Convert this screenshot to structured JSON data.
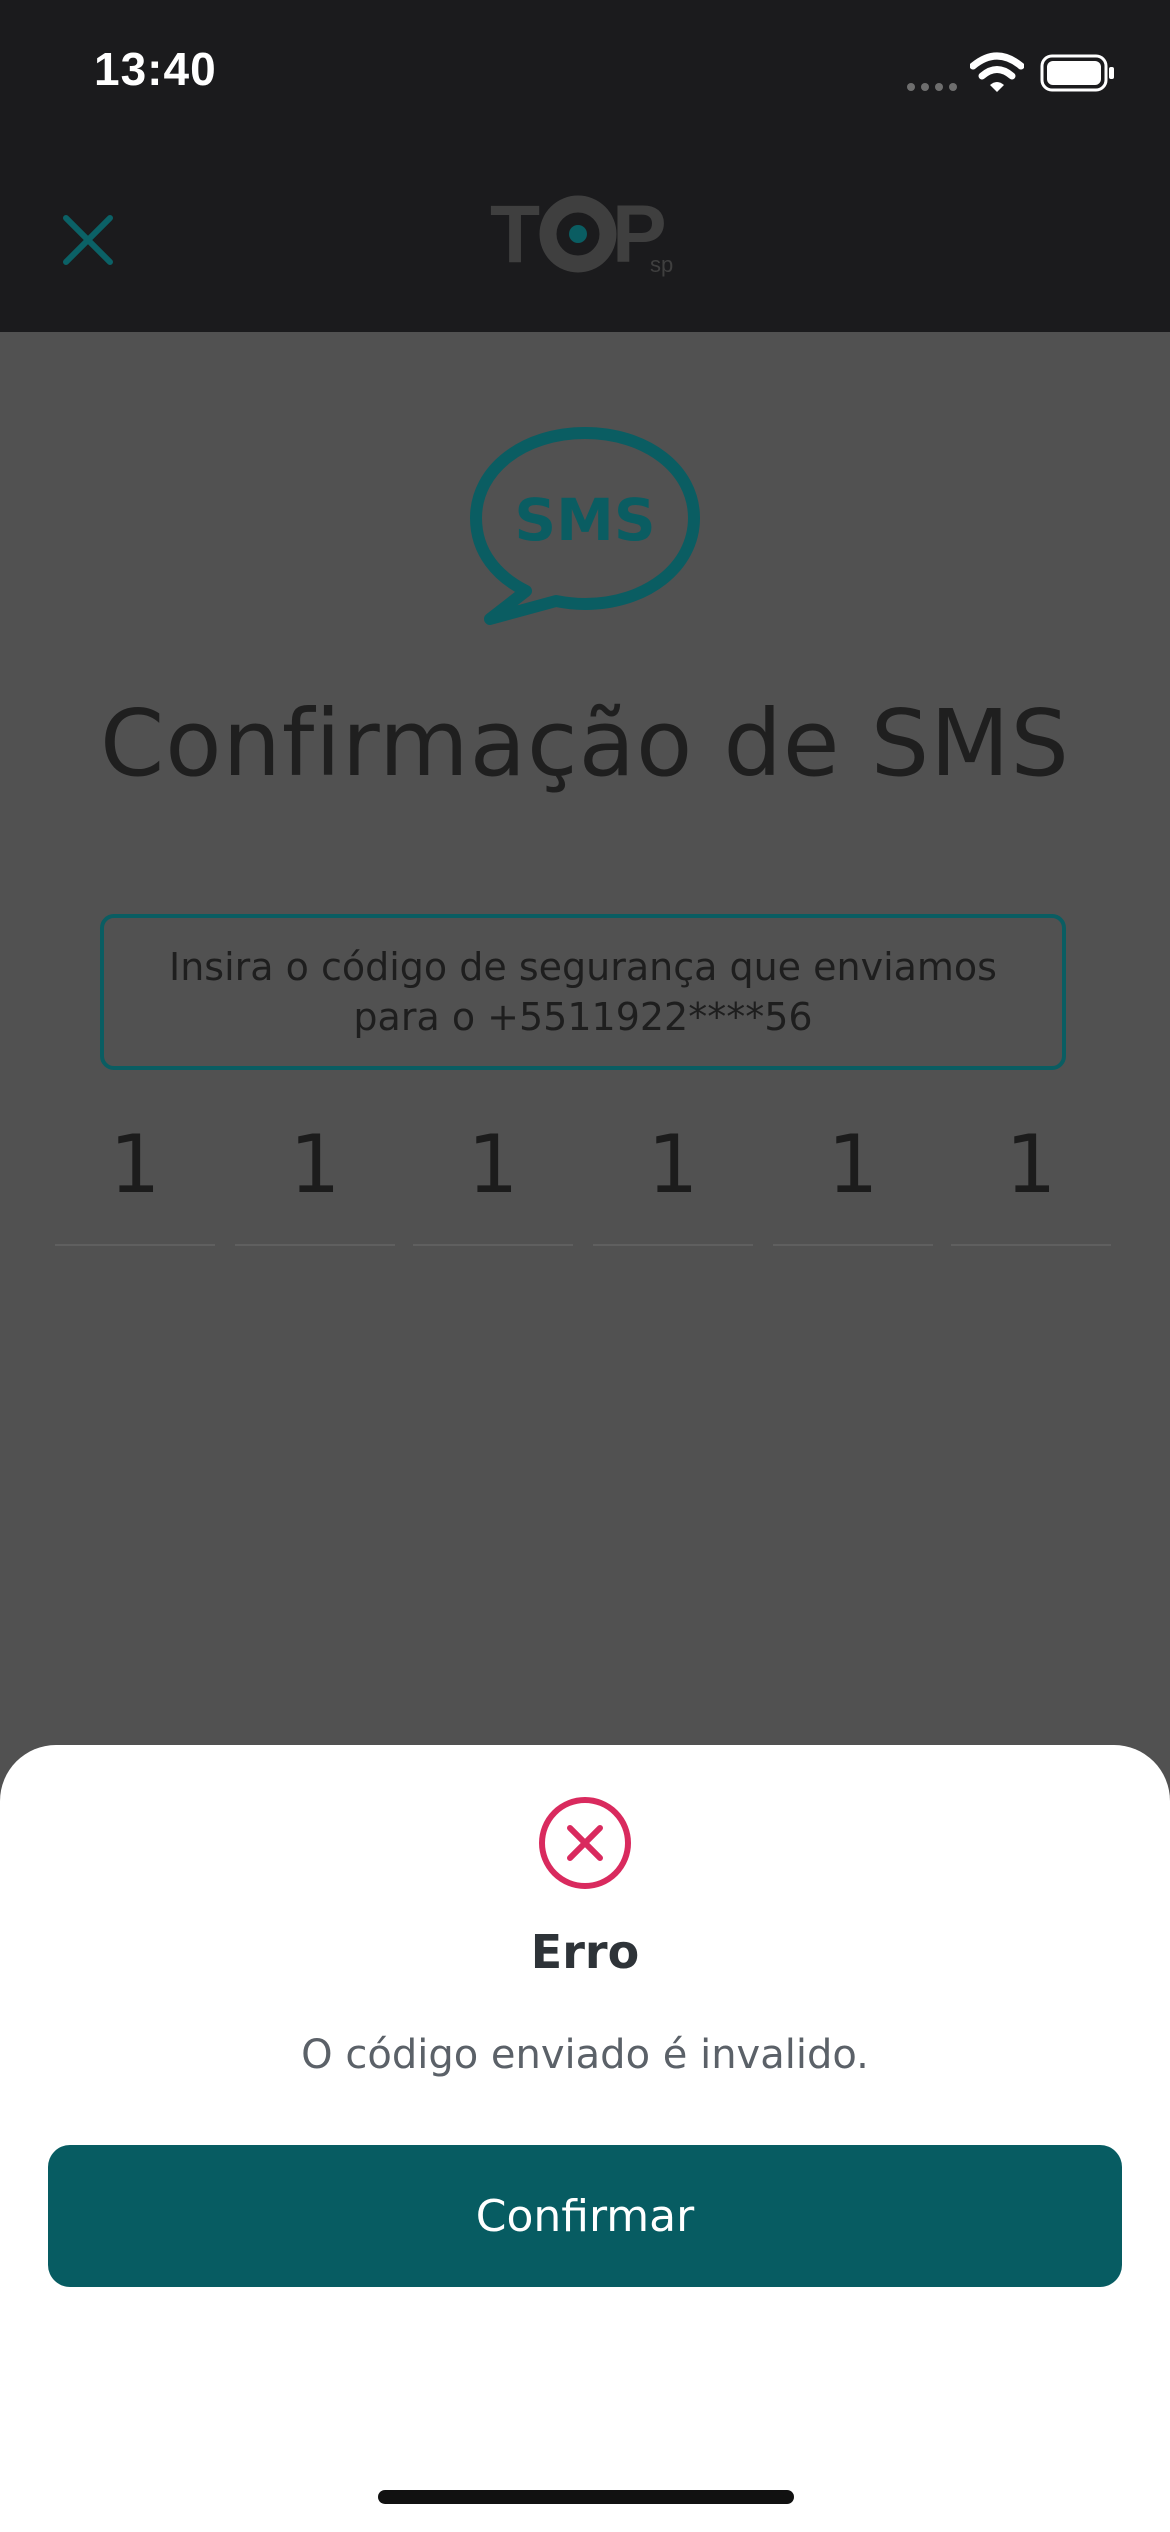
{
  "status_bar": {
    "time": "13:40"
  },
  "navbar": {
    "close_icon": "close-icon",
    "logo_text": "TOP",
    "logo_sub": "sp"
  },
  "screen": {
    "sms_icon_label": "SMS",
    "title": "Confirmação de SMS",
    "info_text": "Insira o código de segurança que enviamos para o +5511922****56",
    "code_digits": [
      "1",
      "1",
      "1",
      "1",
      "1",
      "1"
    ]
  },
  "dialog": {
    "icon": "error-circle-x-icon",
    "title": "Erro",
    "message": "O código enviado é invalido.",
    "confirm_label": "Confirmar"
  },
  "colors": {
    "accent": "#075c62",
    "error": "#d92a5e",
    "dark_bar": "#1b1b1d",
    "overlay": "#515151"
  }
}
